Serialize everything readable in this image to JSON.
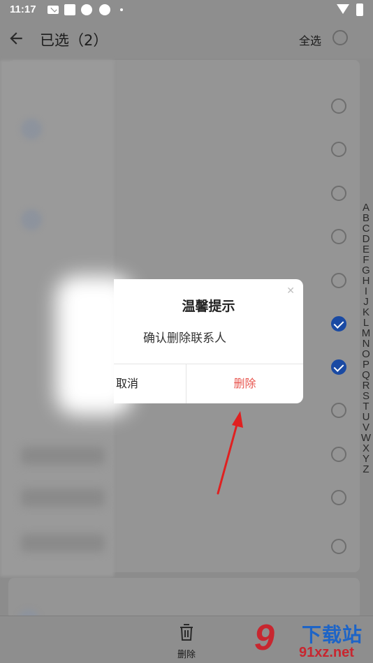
{
  "status_bar": {
    "time": "11:17",
    "icons": [
      "mail-icon",
      "square-icon",
      "shutter-icon",
      "shutter-icon",
      "dot-icon",
      "wifi-icon",
      "battery-charging-icon"
    ]
  },
  "app_bar": {
    "back_icon": "back-arrow-icon",
    "title": "已选（2）",
    "select_all_label": "全选"
  },
  "list": {
    "rows": [
      {
        "checked": false
      },
      {
        "checked": false
      },
      {
        "checked": false
      },
      {
        "checked": false
      },
      {
        "checked": false
      },
      {
        "checked": true
      },
      {
        "checked": true
      },
      {
        "checked": false
      },
      {
        "checked": false
      },
      {
        "checked": false
      },
      {
        "checked": false
      }
    ]
  },
  "side_index": [
    "A",
    "B",
    "C",
    "D",
    "E",
    "F",
    "G",
    "H",
    "I",
    "J",
    "K",
    "L",
    "M",
    "N",
    "O",
    "P",
    "Q",
    "R",
    "S",
    "T",
    "U",
    "V",
    "W",
    "X",
    "Y",
    "Z"
  ],
  "dialog": {
    "title": "温馨提示",
    "message": "确认删除联系人",
    "cancel_label": "取消",
    "confirm_label": "删除",
    "close_icon": "close-icon"
  },
  "bottom_bar": {
    "delete_label": "删除",
    "icon": "trash-icon"
  },
  "watermark": {
    "logo": "9",
    "title": "下载站",
    "url": "91xz.net"
  },
  "colors": {
    "accent": "#1a4aa3",
    "danger": "#e8554e",
    "annotation_arrow": "#e02020"
  }
}
